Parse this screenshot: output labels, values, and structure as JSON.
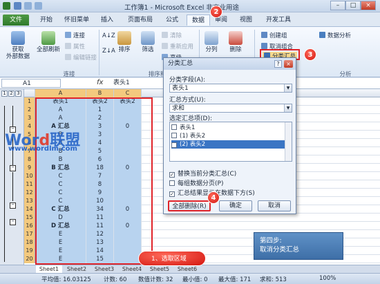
{
  "window": {
    "title": "工作簿1 - Microsoft Excel 非商业用途",
    "min": "–",
    "max": "□",
    "close": "×"
  },
  "tabs": [
    {
      "label": "文件"
    },
    {
      "label": "开始"
    },
    {
      "label": "怀旧菜单"
    },
    {
      "label": "插入"
    },
    {
      "label": "页面布局"
    },
    {
      "label": "公式"
    },
    {
      "label": "数据"
    },
    {
      "label": "审阅"
    },
    {
      "label": "视图"
    },
    {
      "label": "开发工具"
    }
  ],
  "ribbon": {
    "get_external": "获取\n外部数据",
    "refresh_all": "全部刷新",
    "connections": "连接",
    "properties": "属性",
    "edit_links": "编辑链接",
    "group_connections": "连接",
    "sort_az": "A↓Z",
    "sort_za": "Z↓A",
    "sort": "排序",
    "filter": "筛选",
    "clear": "清除",
    "reapply": "重新应用",
    "advanced": "高级",
    "group_sort": "排序和筛选",
    "text_to_columns": "分列",
    "remove_dup": "删除",
    "dup_suffix": "重复项",
    "create_group": "创建组",
    "ungroup": "取消组合",
    "subtotal": "分类汇总",
    "data_analysis": "数据分析",
    "group_analysis": "分析"
  },
  "formula": {
    "namebox": "A1",
    "fx": "fx",
    "content": "表头1"
  },
  "outline_levels": [
    "1",
    "2",
    "3"
  ],
  "outline_minus": "–",
  "columns": [
    "A",
    "B",
    "C"
  ],
  "rows": [
    {
      "n": "1",
      "a": "表头1",
      "b": "表头2",
      "c": "表头2"
    },
    {
      "n": "2",
      "a": "A",
      "b": "1",
      "c": ""
    },
    {
      "n": "3",
      "a": "A",
      "b": "2",
      "c": ""
    },
    {
      "n": "4",
      "a": "A 汇总",
      "b": "3",
      "c": "0",
      "bold": true
    },
    {
      "n": "5",
      "a": "B",
      "b": "3",
      "c": ""
    },
    {
      "n": "6",
      "a": "B",
      "b": "4",
      "c": ""
    },
    {
      "n": "7",
      "a": "B",
      "b": "5",
      "c": ""
    },
    {
      "n": "8",
      "a": "B",
      "b": "6",
      "c": ""
    },
    {
      "n": "9",
      "a": "B 汇总",
      "b": "18",
      "c": "0",
      "bold": true
    },
    {
      "n": "10",
      "a": "C",
      "b": "7",
      "c": ""
    },
    {
      "n": "11",
      "a": "C",
      "b": "8",
      "c": ""
    },
    {
      "n": "12",
      "a": "C",
      "b": "9",
      "c": ""
    },
    {
      "n": "13",
      "a": "C",
      "b": "10",
      "c": ""
    },
    {
      "n": "14",
      "a": "C 汇总",
      "b": "34",
      "c": "0",
      "bold": true
    },
    {
      "n": "15",
      "a": "D",
      "b": "11",
      "c": ""
    },
    {
      "n": "16",
      "a": "D 汇总",
      "b": "11",
      "c": "0",
      "bold": true
    },
    {
      "n": "17",
      "a": "E",
      "b": "12",
      "c": ""
    },
    {
      "n": "18",
      "a": "E",
      "b": "13",
      "c": ""
    },
    {
      "n": "19",
      "a": "E",
      "b": "14",
      "c": ""
    },
    {
      "n": "20",
      "a": "E",
      "b": "15",
      "c": ""
    }
  ],
  "sheets": [
    "Sheet1",
    "Sheet2",
    "Sheet3",
    "Sheet4",
    "Sheet5",
    "Sheet6"
  ],
  "status": {
    "average": "平均值: 16.03125",
    "count": "计数: 60",
    "numcount": "数值计数: 32",
    "min": "最小值: 0",
    "max": "最大值: 171",
    "sum": "求和: 513",
    "zoom": "100%"
  },
  "dialog": {
    "title": "分类汇总",
    "help": "?",
    "close": "×",
    "field_label": "分类字段(A):",
    "field_value": "表头1",
    "method_label": "汇总方式(U):",
    "method_value": "求和",
    "items_label": "选定汇总项(D):",
    "items": [
      {
        "text": "表头1",
        "checked": false,
        "mark": ""
      },
      {
        "text": "(1) 表头2",
        "checked": false,
        "mark": ""
      },
      {
        "text": "(2) 表头2",
        "checked": true,
        "mark": "✓"
      }
    ],
    "replace": "替换当前分类汇总(C)",
    "pagebreak": "每组数据分页(P)",
    "below": "汇总结果显示在数据下方(S)",
    "replace_mark": "✓",
    "pagebreak_mark": "",
    "below_mark": "✓",
    "remove_all": "全部删除(R)",
    "ok": "确定",
    "cancel": "取消"
  },
  "badges": {
    "b2": "2",
    "b3": "3",
    "b4": "4"
  },
  "callout": "1、选取区域",
  "step": {
    "line1": "第四步:",
    "line2": "取消分类汇总"
  },
  "watermark": {
    "brand_a": "Wor",
    "brand_b": "d",
    "brand_c": "联盟",
    "url": "www.wordlm.com"
  },
  "colors": {
    "accent": "#e0242a",
    "selection": "#b8d3ef",
    "file_tab": "#2f7a2c"
  }
}
